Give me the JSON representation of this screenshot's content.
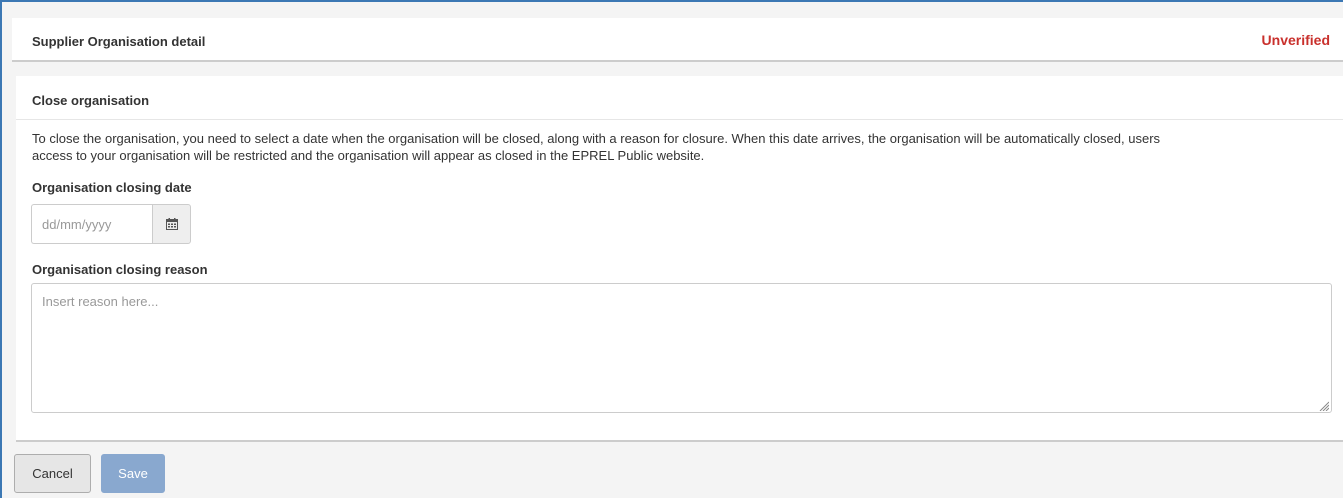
{
  "header": {
    "title": "Supplier Organisation detail",
    "status": "Unverified",
    "status_color": "#c9302c"
  },
  "section": {
    "heading": "Close organisation",
    "intro_line1": "To close the organisation, you need to select a date when the organisation will be closed, along with a reason for closure. When this date arrives, the organisation will be automatically closed, users",
    "intro_line2": "access to your organisation will be restricted and the organisation will appear as closed in the EPREL Public website."
  },
  "form": {
    "date_label": "Organisation closing date",
    "date_placeholder": "dd/mm/yyyy",
    "date_value": "",
    "calendar_icon": "calendar-icon",
    "reason_label": "Organisation closing reason",
    "reason_placeholder": "Insert reason here...",
    "reason_value": ""
  },
  "actions": {
    "cancel_label": "Cancel",
    "save_label": "Save",
    "save_disabled": true,
    "accent_color": "#3c78b4"
  }
}
